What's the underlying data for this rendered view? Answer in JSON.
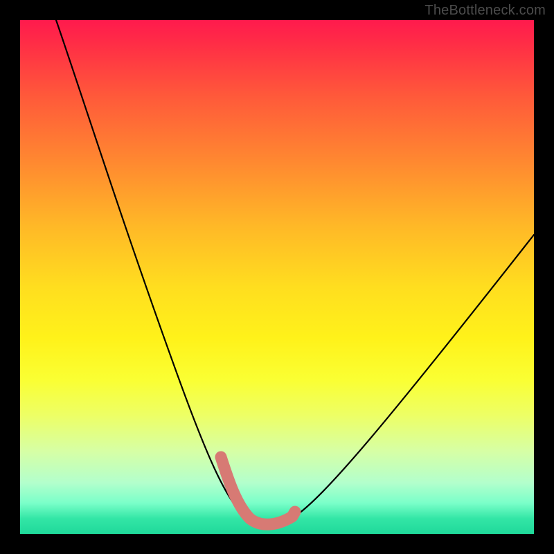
{
  "watermark": "TheBottleneck.com",
  "chart_data": {
    "type": "line",
    "title": "",
    "xlabel": "",
    "ylabel": "",
    "xlim": [
      0,
      100
    ],
    "ylim": [
      0,
      100
    ],
    "series": [
      {
        "name": "bottleneck-curve",
        "x": [
          7,
          10,
          14,
          18,
          22,
          26,
          30,
          34,
          37,
          40,
          42,
          44,
          47,
          50,
          53,
          58,
          64,
          71,
          80,
          90,
          100
        ],
        "values": [
          100,
          90,
          78,
          67,
          57,
          47,
          38,
          29,
          22,
          15,
          10,
          6,
          3,
          2,
          3,
          7,
          14,
          23,
          34,
          46,
          58
        ]
      }
    ],
    "annotations": [
      {
        "name": "highlight-segment",
        "x_range": [
          39,
          53
        ],
        "y_range": [
          2,
          14
        ]
      }
    ]
  },
  "colors": {
    "curve": "#000000",
    "highlight": "#d77a74",
    "frame": "#000000"
  }
}
